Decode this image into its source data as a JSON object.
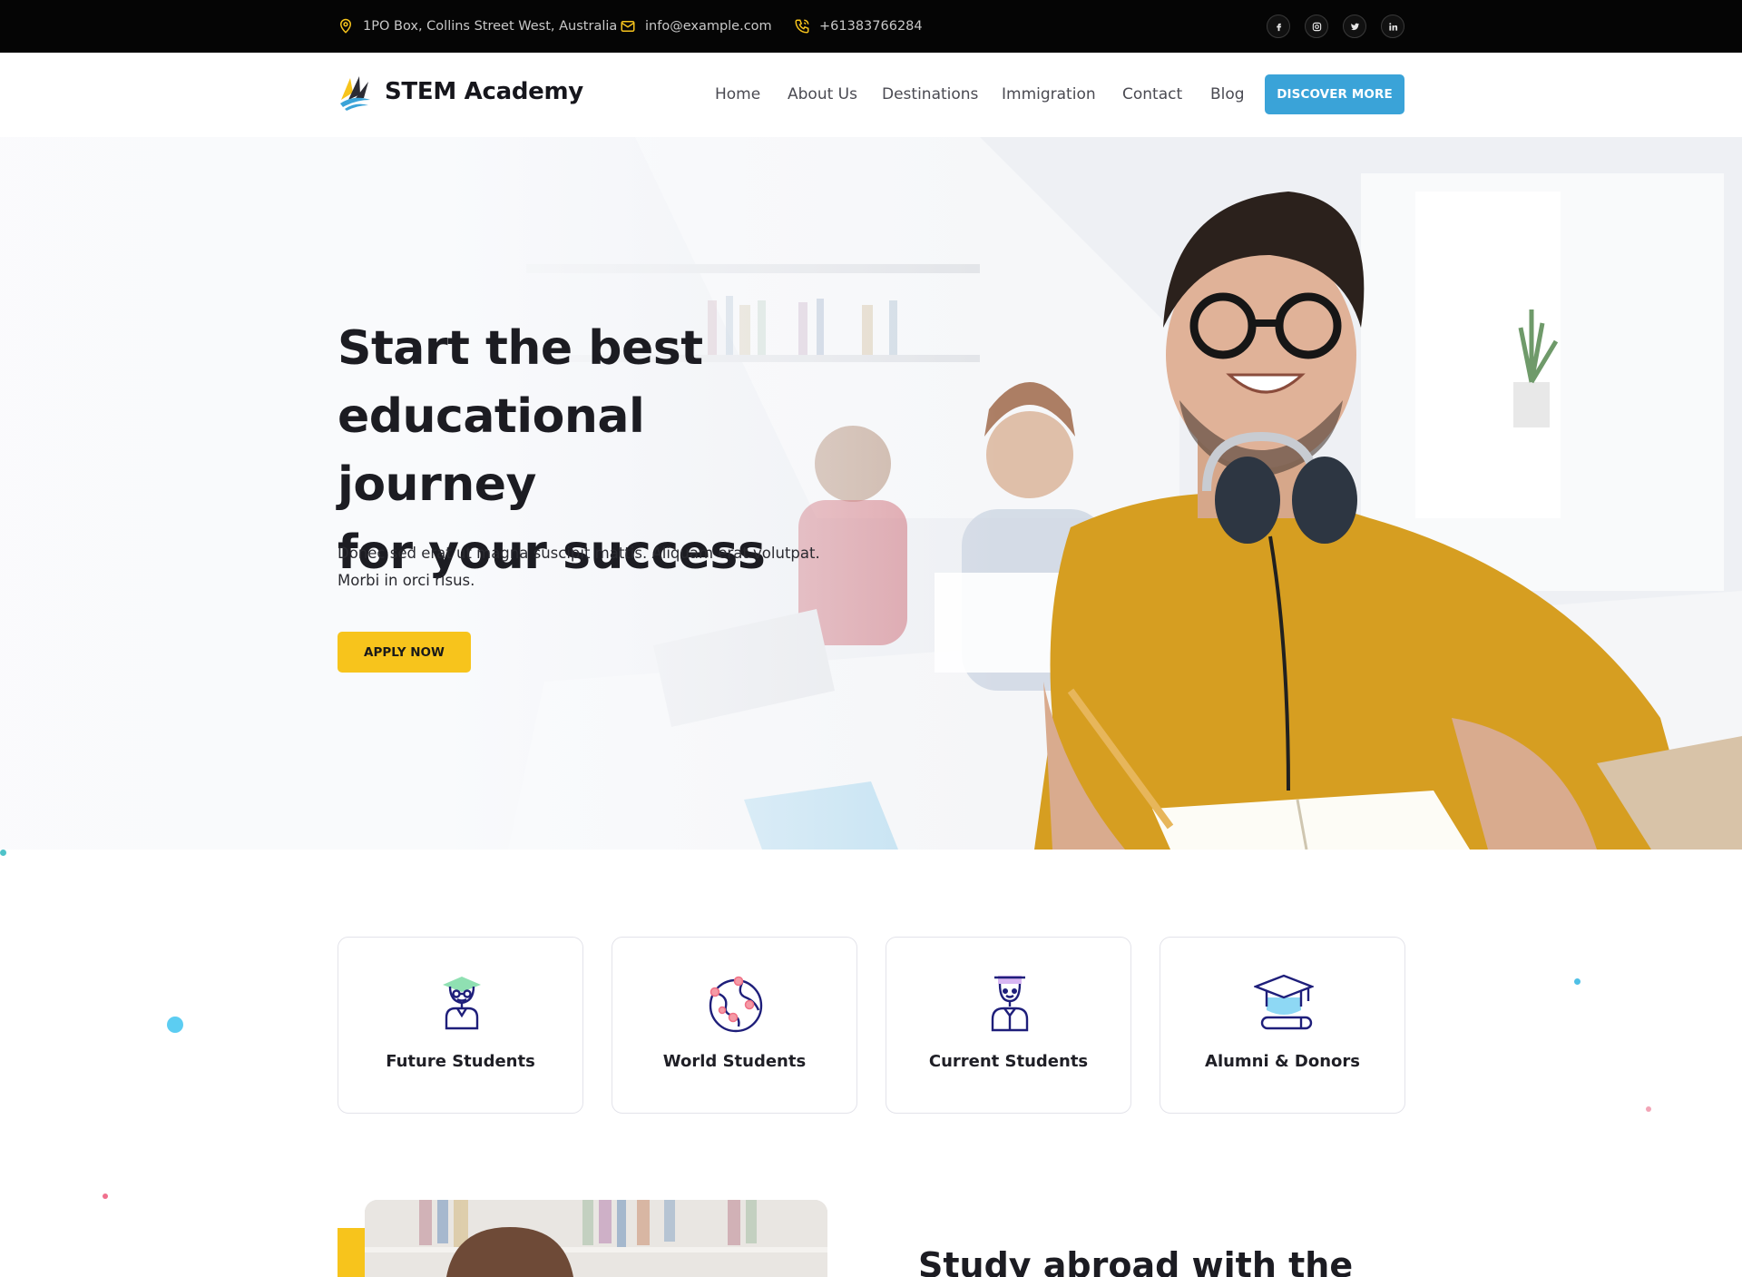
{
  "topbar": {
    "address": "1PO Box, Collins Street West, Australia",
    "email": "info@example.com",
    "phone": "+61383766284",
    "social": [
      "facebook",
      "instagram",
      "twitter",
      "linkedin"
    ]
  },
  "header": {
    "brand": "STEM Academy",
    "nav": [
      "Home",
      "About Us",
      "Destinations",
      "Immigration",
      "Contact",
      "Blog"
    ],
    "cta_label": "DISCOVER MORE"
  },
  "hero": {
    "title_lines": [
      "Start the best",
      "educational journey",
      "for your success"
    ],
    "text_lines": [
      "Donec sed erat ut magna suscipit mattis. Aliquam erat volutpat.",
      "Morbi in orci risus."
    ],
    "button_label": "APPLY NOW"
  },
  "cards": [
    {
      "label": "Future Students",
      "icon": "graduate-student-icon"
    },
    {
      "label": "World Students",
      "icon": "globe-pins-icon"
    },
    {
      "label": "Current Students",
      "icon": "student-icon"
    },
    {
      "label": "Alumni & Donors",
      "icon": "graduation-cap-icon"
    }
  ],
  "about": {
    "title": "Study abroad with the"
  },
  "colors": {
    "accent_blue": "#3aa3d8",
    "accent_yellow": "#f7c41c",
    "icon_navy": "#1e1e7a",
    "dark": "#050505"
  }
}
